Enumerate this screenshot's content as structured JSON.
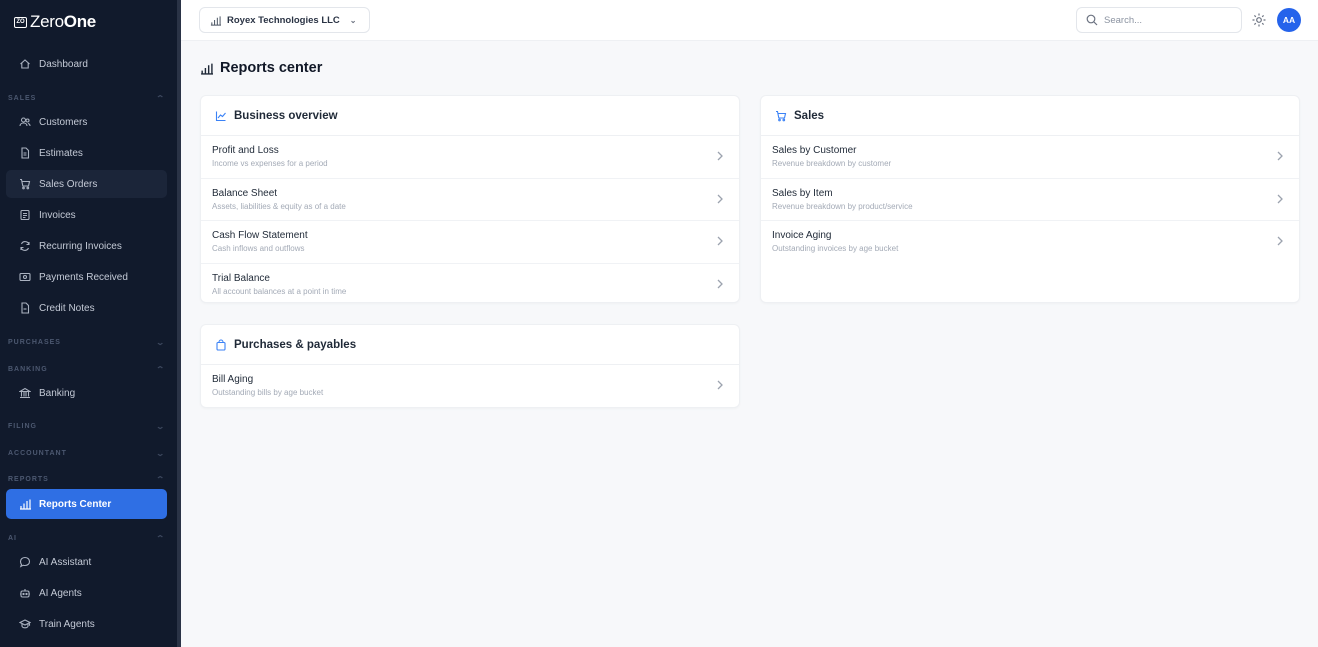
{
  "brand": {
    "mark": "ZO",
    "name_a": "Zero",
    "name_b": "One"
  },
  "sidebar": {
    "items": [
      {
        "label": "Dashboard",
        "icon": "home-icon"
      },
      {
        "label": "Customers",
        "icon": "users-icon"
      },
      {
        "label": "Estimates",
        "icon": "document-icon"
      },
      {
        "label": "Sales Orders",
        "icon": "cart-icon"
      },
      {
        "label": "Invoices",
        "icon": "invoice-icon"
      },
      {
        "label": "Recurring Invoices",
        "icon": "refresh-icon"
      },
      {
        "label": "Payments Received",
        "icon": "payment-icon"
      },
      {
        "label": "Credit Notes",
        "icon": "credit-note-icon"
      },
      {
        "label": "Banking",
        "icon": "bank-icon"
      },
      {
        "label": "Reports Center",
        "icon": "reports-icon"
      },
      {
        "label": "AI Assistant",
        "icon": "chat-icon"
      },
      {
        "label": "AI Agents",
        "icon": "robot-icon"
      },
      {
        "label": "Train Agents",
        "icon": "graduation-icon"
      }
    ],
    "sections": [
      "SALES",
      "PURCHASES",
      "BANKING",
      "FILING",
      "ACCOUNTANT",
      "REPORTS",
      "AI"
    ]
  },
  "topbar": {
    "company": "Royex Technologies LLC",
    "search_placeholder": "Search...",
    "avatar": "AA"
  },
  "page": {
    "title": "Reports center"
  },
  "cards": {
    "business": {
      "title": "Business overview",
      "rows": [
        {
          "title": "Profit and Loss",
          "sub": "Income vs expenses for a period"
        },
        {
          "title": "Balance Sheet",
          "sub": "Assets, liabilities & equity as of a date"
        },
        {
          "title": "Cash Flow Statement",
          "sub": "Cash inflows and outflows"
        },
        {
          "title": "Trial Balance",
          "sub": "All account balances at a point in time"
        }
      ]
    },
    "sales": {
      "title": "Sales",
      "rows": [
        {
          "title": "Sales by Customer",
          "sub": "Revenue breakdown by customer"
        },
        {
          "title": "Sales by Item",
          "sub": "Revenue breakdown by product/service"
        },
        {
          "title": "Invoice Aging",
          "sub": "Outstanding invoices by age bucket"
        }
      ]
    },
    "purchases": {
      "title": "Purchases & payables",
      "rows": [
        {
          "title": "Bill Aging",
          "sub": "Outstanding bills by age bucket"
        }
      ]
    }
  },
  "colors": {
    "sidebar_bg": "#111a2c",
    "accent": "#2f6fe4",
    "avatar": "#2563eb",
    "card_icon": "#3b82f6"
  }
}
